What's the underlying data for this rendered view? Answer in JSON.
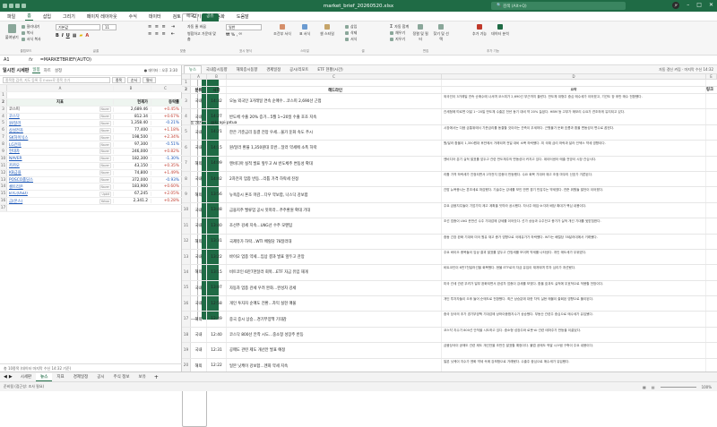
{
  "window": {
    "title": "market_brief_20260520.xlsx",
    "search_placeholder": "검색 (Alt+Q)",
    "user": "JY"
  },
  "menu": {
    "items": [
      "파일",
      "홈",
      "삽입",
      "그리기",
      "페이지 레이아웃",
      "수식",
      "데이터",
      "검토",
      "보기",
      "자동화",
      "도움말"
    ],
    "share": "공유",
    "comments": "메모"
  },
  "ribbon": {
    "paste": "붙여넣기",
    "cut": "잘라내기",
    "copy": "복사",
    "format_painter": "서식 복사",
    "font_name": "기본값",
    "font_size": "11",
    "wrap": "자동 줄 바꿈",
    "merge": "병합하고 가운데 맞춤",
    "number_format": "일반",
    "cond_format": "조건부 서식",
    "table_format": "표 서식",
    "cell_style": "셀 스타일",
    "insert": "삽입",
    "delete": "삭제",
    "format": "서식",
    "sum": "자동 합계",
    "fill": "채우기",
    "clear": "지우기",
    "sort": "정렬 및 필터",
    "find": "찾기 및 선택",
    "addins": "추가 기능",
    "analyze": "데이터 분석",
    "groups": [
      "클립보드",
      "글꼴",
      "맞춤",
      "표시 형식",
      "스타일",
      "셀",
      "편집",
      "추가 기능"
    ]
  },
  "formula": {
    "cell": "A1",
    "fx": "fx",
    "value": "=MARKETBRIEF(AUTO)",
    "right1": "자동 갱신",
    "right2": "@kcapigatua"
  },
  "left_panel": {
    "title": "일시진 시세판",
    "tab_on": "일봉",
    "tab2": "차트",
    "tab3": "설정",
    "status": "● 데이터 : 오후 3:30",
    "search": "종목명 검색, 지도 등록 후 Enter로 종목 추가",
    "btn1": "종목",
    "btn2": "순서",
    "btn3": "필터",
    "footer": "총 10종목 (데이터 마지막 수신 14:32 기준)"
  },
  "left_cols": [
    "A",
    "B",
    "C"
  ],
  "left_rows": [
    {
      "n": "1",
      "a": "",
      "b": "",
      "c": ""
    },
    {
      "n": "2",
      "a": "지표",
      "b": "현재가",
      "c": "등락률",
      "h": true
    },
    {
      "n": "3",
      "a": "코스피",
      "tag": "Naver",
      "b": "2,689.46",
      "c": "+0.45%",
      "cc": "up",
      "link": false
    },
    {
      "n": "4",
      "a": "코스닥",
      "tag": "Naver",
      "b": "812.34",
      "c": "+0.67%",
      "cc": "up",
      "link": true
    },
    {
      "n": "5",
      "a": "원/달러",
      "tag": "Naver",
      "b": "1,358.40",
      "c": "-0.21%",
      "cc": "dn",
      "link": true
    },
    {
      "n": "6",
      "a": "삼성전자",
      "tag": "Naver",
      "b": "77,400",
      "c": "+1.18%",
      "cc": "up",
      "link": true
    },
    {
      "n": "7",
      "a": "SK하이닉스",
      "tag": "Naver",
      "b": "198,500",
      "c": "+2.34%",
      "cc": "up",
      "link": true
    },
    {
      "n": "8",
      "a": "LG전자",
      "tag": "Naver",
      "b": "97,300",
      "c": "-0.51%",
      "cc": "dn",
      "link": true
    },
    {
      "n": "9",
      "a": "현대차",
      "tag": "Naver",
      "b": "246,000",
      "c": "+0.82%",
      "cc": "up",
      "link": true
    },
    {
      "n": "10",
      "a": "NAVER",
      "tag": "Naver",
      "b": "182,300",
      "c": "-1.30%",
      "cc": "dn",
      "link": true
    },
    {
      "n": "11",
      "a": "카카오",
      "tag": "Naver",
      "b": "43,150",
      "c": "+0.35%",
      "cc": "up",
      "link": true
    },
    {
      "n": "12",
      "a": "KB금융",
      "tag": "Naver",
      "b": "74,800",
      "c": "+1.49%",
      "cc": "up",
      "link": true
    },
    {
      "n": "13",
      "a": "POSCO홀딩스",
      "tag": "Naver",
      "b": "372,000",
      "c": "-0.93%",
      "cc": "dn",
      "link": true
    },
    {
      "n": "14",
      "a": "셀트리온",
      "tag": "Naver",
      "b": "183,900",
      "c": "+0.60%",
      "cc": "up",
      "link": true
    },
    {
      "n": "15",
      "a": "BTC(USD)",
      "tag": "Upbit",
      "b": "67,245",
      "c": "+2.05%",
      "cc": "up",
      "link": true
    },
    {
      "n": "16",
      "a": "금(온스)",
      "tag": "Yahoo",
      "b": "2,341.2",
      "c": "+0.28%",
      "cc": "up",
      "link": true
    },
    {
      "n": "17",
      "a": "",
      "b": "",
      "c": ""
    }
  ],
  "right_tabs": [
    "뉴스",
    "국내증시동향",
    "해외증시동향",
    "경제일정",
    "공시/리포트",
    "ETF 현황(시간)"
  ],
  "right_info": "자동 갱신 켜짐 · 마지막 수신 14:32",
  "right_cols": [
    "",
    "A",
    "B",
    "C",
    "D",
    "E"
  ],
  "right_header": {
    "a": "분류",
    "b": "시각",
    "c": "헤드라인",
    "d": "요약",
    "e": "링크"
  },
  "news": [
    {
      "n": "3",
      "a": "국내",
      "b": "14:32",
      "c": "오늘 외국인 3거래일 연속 순매수…코스피 2,690선 근접",
      "d": "외국인이 3거래일 연속 순매수에 나서며 코스피가 2,690선 부근까지 올랐다. 반도체 대형주 중심 매수세가 이어졌고, 기관도 장 후반 매수 전환했다."
    },
    {
      "n": "4",
      "a": "국내",
      "b": "14:27",
      "c": "반도체 수출 20% 증가…5월 1~20일 수출 호조 지속",
      "d": "관세청에 따르면 이달 1~20일 반도체 수출은 전년 동기 대비 약 20% 늘었다. HBM 등 고부가 메모리 수요가 견조하게 유지되고 있다."
    },
    {
      "n": "5",
      "a": "국내",
      "b": "14:21",
      "c": "한은 기준금리 동결 전망 우세…물가 둔화 속도 주시",
      "d": "시장에서는 다음 금통위에서 기준금리를 동결할 것이라는 관측이 우세하다. 근원물가 둔화 흐름과 환율 변동성이 변수로 꼽힌다."
    },
    {
      "n": "6",
      "a": "국내",
      "b": "14:15",
      "c": "원/달러 환율 1,350원대 후반…달러 약세에 소폭 하락",
      "d": "원/달러 환율이 1,350원대 후반에서 거래되며 전일 대비 소폭 하락했다. 미 국채 금리 하락과 달러 인덱스 약세 영향이다."
    },
    {
      "n": "7",
      "a": "해외",
      "b": "14:09",
      "c": "엔비디아 실적 발표 앞두고 AI 반도체주 변동성 확대",
      "d": "엔비디아 분기 실적 발표를 앞두고 관련 반도체주의 변동성이 커지고 있다. 데이터센터 매출 전망이 시장 관심사다."
    },
    {
      "n": "8",
      "a": "국내",
      "b": "14:02",
      "c": "2차전지 업종 반등…리튬 가격 하락세 진정",
      "d": "리튬 가격 하락세가 진정되면서 2차전지 업종이 반등했다. 수요 회복 기대와 재고 조정 마무리 신호가 거론된다."
    },
    {
      "n": "9",
      "a": "해외",
      "b": "13:56",
      "c": "뉴욕증시 혼조 마감…다우 약보합, 나스닥 강보합",
      "d": "간밤 뉴욕증시는 혼조세로 마감했다. 기술주는 강세를 보인 반면 경기 민감주는 약세였다. 연준 위원들 발언이 이어졌다."
    },
    {
      "n": "10",
      "a": "국내",
      "b": "13:48",
      "c": "금융지주 밸류업 공시 잇따라…주주환원 확대 기대",
      "d": "주요 금융지주들이 기업가치 제고 계획을 잇따라 공시했다. 자사주 매입·소각과 배당 확대가 핵심 내용이다."
    },
    {
      "n": "11",
      "a": "국내",
      "b": "13:40",
      "c": "조선주 강세 지속…LNG선 수주 모멘텀",
      "d": "조선 업종이 LNG 운반선 수주 기대감에 강세를 이어갔다. 선가 상승과 수주잔고 증가가 실적 개선 기대를 뒷받침한다."
    },
    {
      "n": "12",
      "a": "해외",
      "b": "13:31",
      "c": "국제유가 하락…WTI 배럴당 78달러대",
      "d": "중동 긴장 완화 기대와 미국 원유 재고 증가 영향으로 국제유가가 하락했다. WTI는 배럴당 78달러대에서 거래됐다."
    },
    {
      "n": "13",
      "a": "국내",
      "b": "13:22",
      "c": "바이오 업종 약세…임상 결과 발표 앞두고 관망",
      "d": "주요 바이오 종목들이 임상 결과 발표를 앞두고 관망세를 보이며 약세를 나타냈다. 개인 매도세가 우위였다."
    },
    {
      "n": "14",
      "a": "해외",
      "b": "13:15",
      "c": "비트코인 6만7천달러 회복…ETF 자금 유입 재개",
      "d": "비트코인이 6만7천달러선을 회복했다. 현물 ETF로의 자금 유입이 재개되며 투자 심리가 개선됐다."
    },
    {
      "n": "15",
      "a": "국내",
      "b": "13:07",
      "c": "자동차 업종 관세 우려 완화…완성차 강세",
      "d": "미국 관세 관련 우려가 일부 완화되면서 완성차 업종이 강세를 보였다. 환율 효과도 실적에 우호적으로 작용할 전망이다."
    },
    {
      "n": "16",
      "a": "국내",
      "b": "12:58",
      "c": "개인 투자자 순매도 전환…차익 실현 매물",
      "d": "개인 투자자들이 오후 들어 순매도로 전환했다. 최근 상승분에 대한 차익 실현 매물이 출회된 영향으로 풀이된다."
    },
    {
      "n": "17",
      "a": "해외",
      "b": "12:49",
      "c": "중국 증시 상승…경기부양책 기대감",
      "d": "중국 당국의 추가 경기부양책 기대감에 상하이종합지수가 상승했다. 부동산 관련주 중심으로 매수세가 유입됐다."
    },
    {
      "n": "18",
      "a": "국내",
      "b": "12:40",
      "c": "코스닥 800선 안착 시도…중소형 성장주 반등",
      "d": "코스닥 지수가 800선 안착을 시도하고 있다. 중소형 성장주와 로봇·AI 관련 테마주가 반등을 이끌었다."
    },
    {
      "n": "19",
      "a": "국내",
      "b": "12:31",
      "c": "공매도 관련 제도 개선안 발표 예정",
      "d": "금융당국이 공매도 관련 제도 개선안을 조만간 발표할 예정이다. 불법 공매도 적발 시스템 구축이 주요 내용이다."
    },
    {
      "n": "20",
      "a": "해외",
      "b": "12:22",
      "c": "일본 닛케이 강보합…엔화 약세 지속",
      "d": "일본 닛케이 지수가 엔화 약세 속에 강보합으로 거래됐다. 수출주 중심으로 매수세가 유입됐다."
    }
  ],
  "sheet_tabs": [
    "시세판",
    "뉴스",
    "지표",
    "경제일정",
    "공시",
    "주식 정보",
    "보유"
  ],
  "status": {
    "left": "준비됨 (접근성: 조사 필요)",
    "zoom": "100%"
  }
}
